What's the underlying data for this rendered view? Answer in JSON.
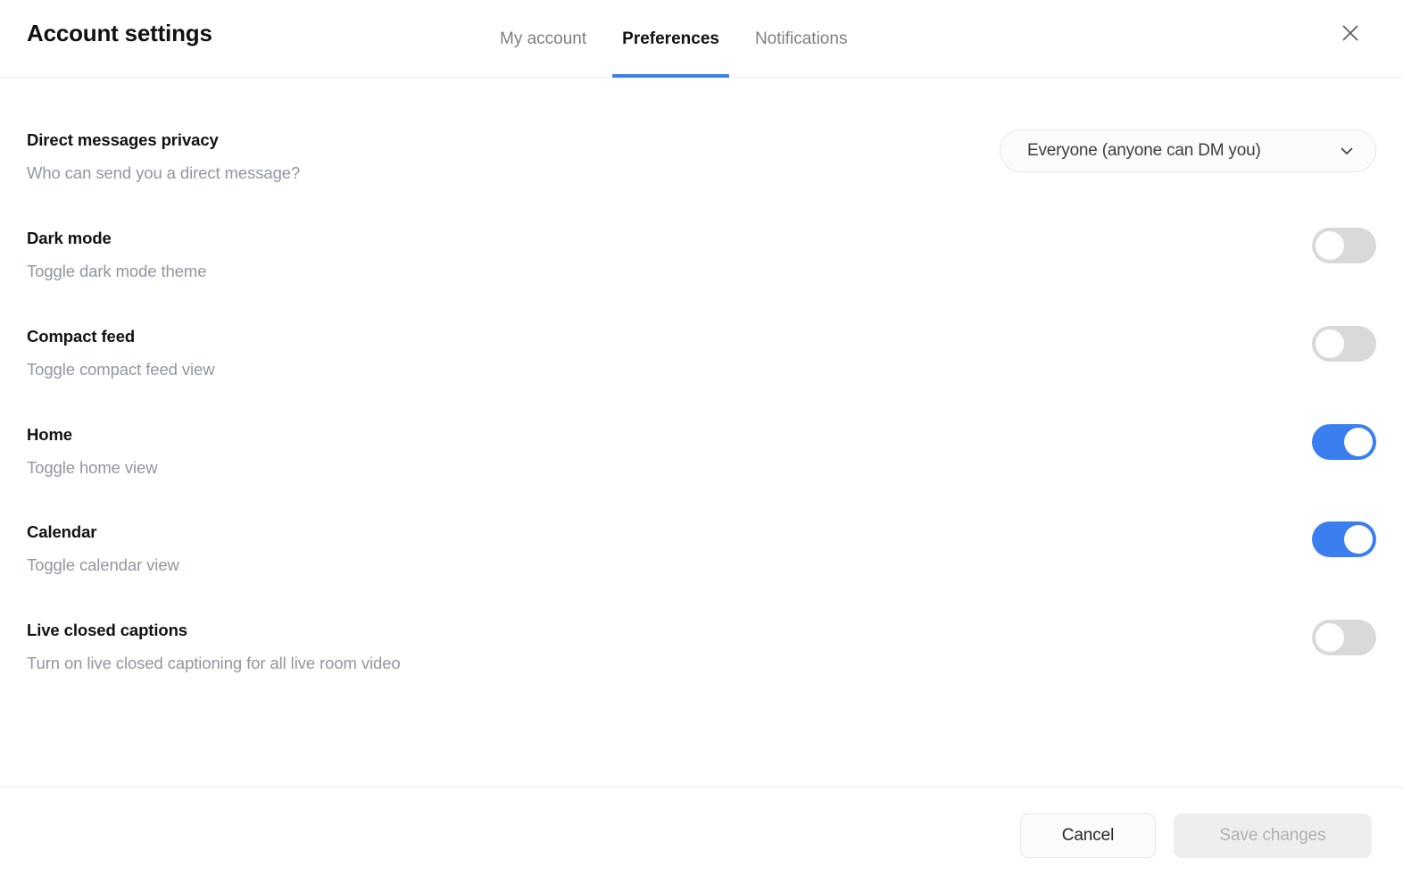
{
  "header": {
    "title": "Account settings",
    "tabs": [
      {
        "label": "My account",
        "active": false
      },
      {
        "label": "Preferences",
        "active": true
      },
      {
        "label": "Notifications",
        "active": false
      }
    ],
    "close_icon": "close-icon"
  },
  "preferences": {
    "rows": [
      {
        "title": "Direct messages privacy",
        "description": "Who can send you a direct message?",
        "control": "select",
        "value": "Everyone (anyone can DM you)"
      },
      {
        "title": "Dark mode",
        "description": "Toggle dark mode theme",
        "control": "toggle",
        "state": "off"
      },
      {
        "title": "Compact feed",
        "description": "Toggle compact feed view",
        "control": "toggle",
        "state": "off"
      },
      {
        "title": "Home",
        "description": "Toggle home view",
        "control": "toggle",
        "state": "on"
      },
      {
        "title": "Calendar",
        "description": "Toggle calendar view",
        "control": "toggle",
        "state": "on"
      },
      {
        "title": "Live closed captions",
        "description": "Turn on live closed captioning for all live room video",
        "control": "toggle",
        "state": "off"
      }
    ]
  },
  "footer": {
    "cancel_label": "Cancel",
    "save_label": "Save changes",
    "save_disabled": true
  },
  "colors": {
    "accent": "#3b7ef0",
    "toggle_off": "#d9d9d9",
    "text_primary": "#101214",
    "text_muted": "#9097a1",
    "divider": "#ececec"
  }
}
